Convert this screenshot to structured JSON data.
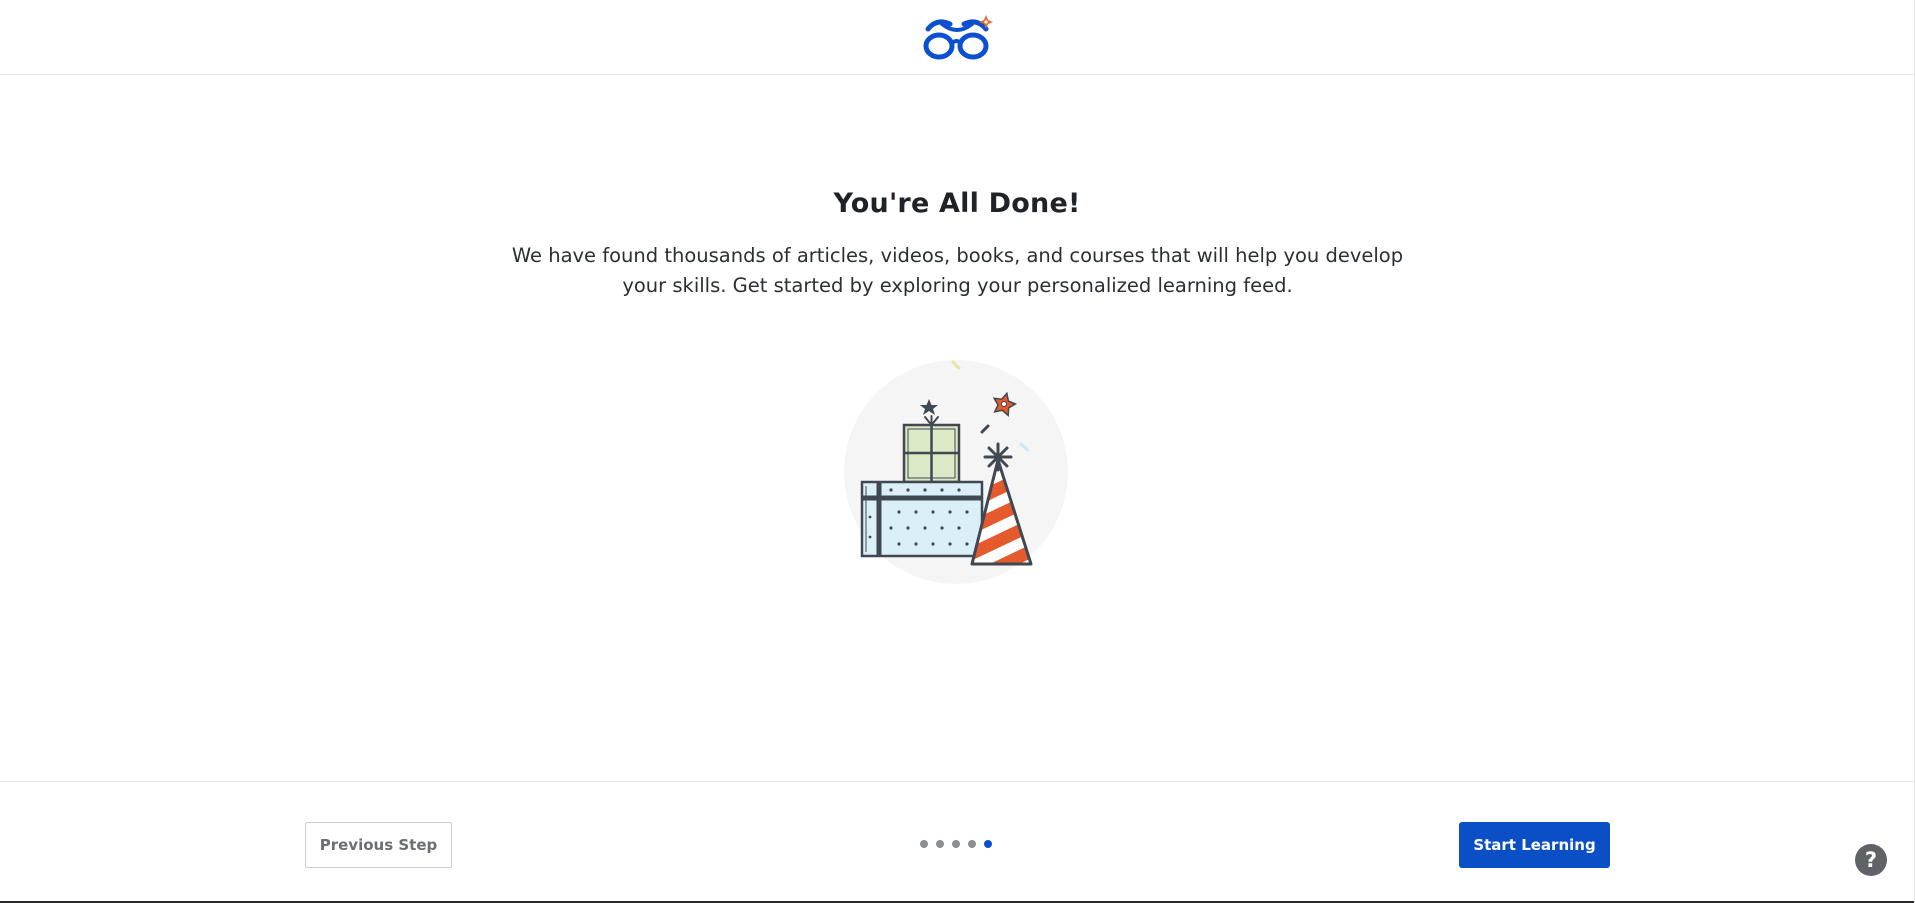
{
  "header": {
    "logo_icon": "glasses-logo-icon",
    "brand_color": "#0a50d0",
    "accent_color": "#e8672a"
  },
  "main": {
    "title": "You're All Done!",
    "subtitle": "We have found thousands of articles, videos, books, and courses that will help you develop your skills. Get started by exploring your personalized learning feed.",
    "illustration_icon": "celebration-gifts-party-hat-icon"
  },
  "footer": {
    "previous_label": "Previous Step",
    "start_label": "Start Learning",
    "help_label": "?",
    "steps_total": 5,
    "current_step": 5,
    "step_dots": [
      {
        "state": "inactive"
      },
      {
        "state": "inactive"
      },
      {
        "state": "inactive"
      },
      {
        "state": "inactive"
      },
      {
        "state": "active"
      }
    ]
  },
  "colors": {
    "primary_button": "#0a4fc5",
    "active_dot": "#0a50c8",
    "inactive_dot": "#8a8f94",
    "help_button": "#5f6368"
  }
}
